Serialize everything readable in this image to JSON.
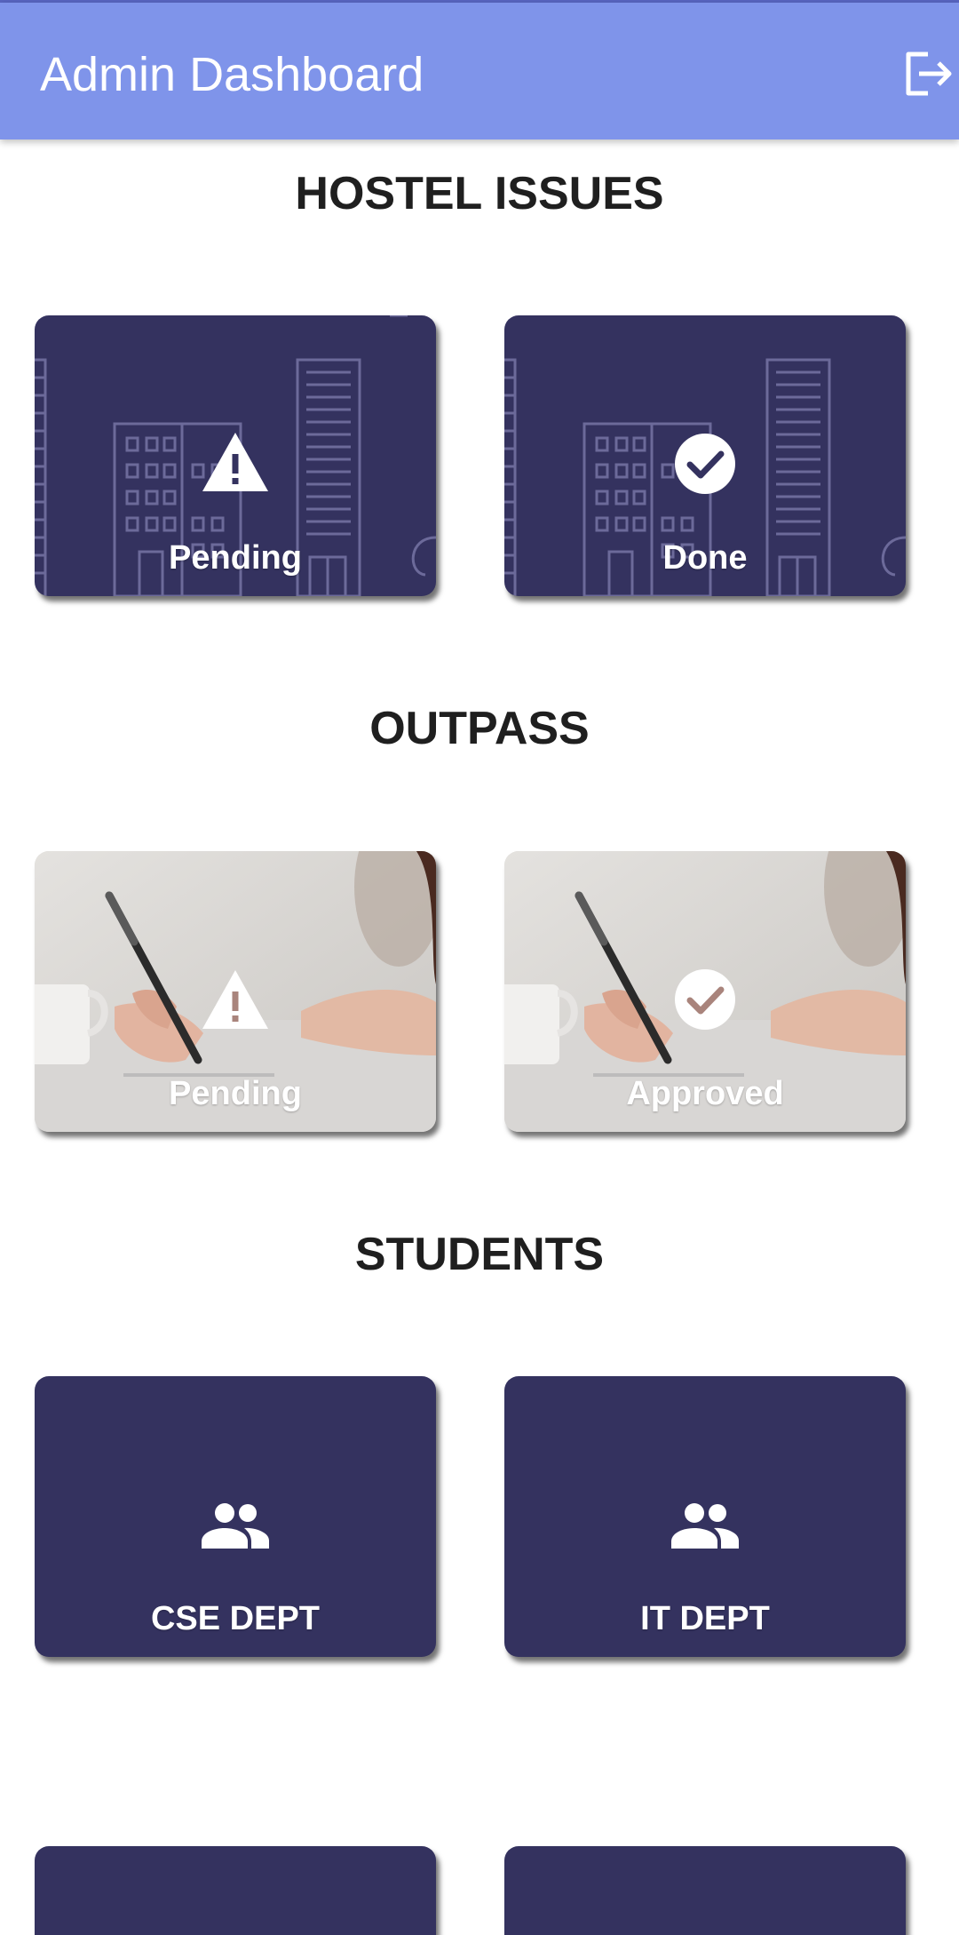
{
  "appbar": {
    "title": "Admin Dashboard",
    "logout_icon": "logout-icon"
  },
  "sections": {
    "hostel": {
      "title": "HOSTEL ISSUES",
      "cards": [
        {
          "label": "Pending",
          "icon": "warning-icon"
        },
        {
          "label": "Done",
          "icon": "check-circle-icon"
        }
      ]
    },
    "outpass": {
      "title": "OUTPASS",
      "cards": [
        {
          "label": "Pending",
          "icon": "warning-icon"
        },
        {
          "label": "Approved",
          "icon": "check-circle-icon"
        }
      ]
    },
    "students": {
      "title": "STUDENTS",
      "cards": [
        {
          "label": "CSE DEPT",
          "icon": "people-icon"
        },
        {
          "label": "IT DEPT",
          "icon": "people-icon"
        }
      ]
    }
  },
  "colors": {
    "appbar": "#7f94ea",
    "card": "#34325f",
    "text": "#1f1f1f"
  }
}
